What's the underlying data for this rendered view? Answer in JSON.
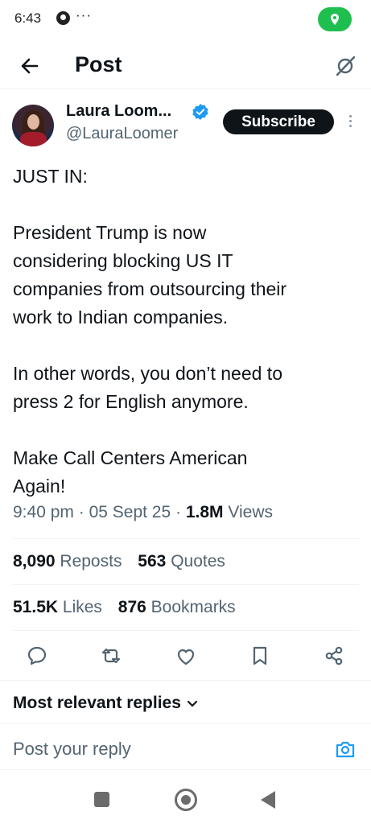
{
  "status_bar": {
    "time": "6:43",
    "overflow": "···",
    "notification_icon": "circle-app-icon",
    "location_icon": "location-pin-icon"
  },
  "header": {
    "title": "Post",
    "back_icon": "arrow-left-icon",
    "grok_icon": "grok-slash-icon"
  },
  "author": {
    "name": "Laura Loom...",
    "handle": "@LauraLoomer",
    "verified": true,
    "subscribe_label": "Subscribe"
  },
  "tweet": {
    "paragraphs": [
      "JUST IN:",
      "President Trump is now\nconsidering blocking US IT\ncompanies from outsourcing their\nwork to Indian companies.",
      "In other words, you don’t need to\npress 2 for English anymore.",
      "Make Call Centers American\nAgain!"
    ],
    "time": "9:40 pm",
    "date": "05 Sept 25",
    "views_count": "1.8M",
    "views_label": "Views"
  },
  "stats": {
    "reposts_count": "8,090",
    "reposts_label": "Reposts",
    "quotes_count": "563",
    "quotes_label": "Quotes",
    "likes_count": "51.5K",
    "likes_label": "Likes",
    "bookmarks_count": "876",
    "bookmarks_label": "Bookmarks"
  },
  "actions": [
    "reply-icon",
    "repost-icon",
    "like-icon",
    "bookmark-icon",
    "share-icon"
  ],
  "replies": {
    "sort_label": "Most relevant replies",
    "reply_placeholder": "Post your reply"
  },
  "colors": {
    "text": "#0f1419",
    "muted": "#536471",
    "accent": "#1d9bf0",
    "status_green": "#1fbf4f"
  }
}
